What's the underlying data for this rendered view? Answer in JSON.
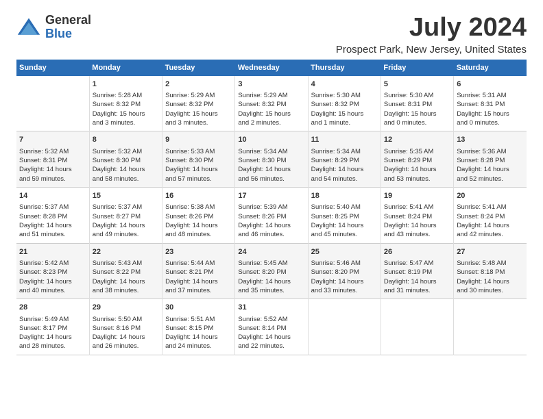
{
  "logo": {
    "general": "General",
    "blue": "Blue"
  },
  "title": "July 2024",
  "location": "Prospect Park, New Jersey, United States",
  "headers": [
    "Sunday",
    "Monday",
    "Tuesday",
    "Wednesday",
    "Thursday",
    "Friday",
    "Saturday"
  ],
  "weeks": [
    [
      {
        "day": "",
        "content": ""
      },
      {
        "day": "1",
        "content": "Sunrise: 5:28 AM\nSunset: 8:32 PM\nDaylight: 15 hours\nand 3 minutes."
      },
      {
        "day": "2",
        "content": "Sunrise: 5:29 AM\nSunset: 8:32 PM\nDaylight: 15 hours\nand 3 minutes."
      },
      {
        "day": "3",
        "content": "Sunrise: 5:29 AM\nSunset: 8:32 PM\nDaylight: 15 hours\nand 2 minutes."
      },
      {
        "day": "4",
        "content": "Sunrise: 5:30 AM\nSunset: 8:32 PM\nDaylight: 15 hours\nand 1 minute."
      },
      {
        "day": "5",
        "content": "Sunrise: 5:30 AM\nSunset: 8:31 PM\nDaylight: 15 hours\nand 0 minutes."
      },
      {
        "day": "6",
        "content": "Sunrise: 5:31 AM\nSunset: 8:31 PM\nDaylight: 15 hours\nand 0 minutes."
      }
    ],
    [
      {
        "day": "7",
        "content": "Sunrise: 5:32 AM\nSunset: 8:31 PM\nDaylight: 14 hours\nand 59 minutes."
      },
      {
        "day": "8",
        "content": "Sunrise: 5:32 AM\nSunset: 8:30 PM\nDaylight: 14 hours\nand 58 minutes."
      },
      {
        "day": "9",
        "content": "Sunrise: 5:33 AM\nSunset: 8:30 PM\nDaylight: 14 hours\nand 57 minutes."
      },
      {
        "day": "10",
        "content": "Sunrise: 5:34 AM\nSunset: 8:30 PM\nDaylight: 14 hours\nand 56 minutes."
      },
      {
        "day": "11",
        "content": "Sunrise: 5:34 AM\nSunset: 8:29 PM\nDaylight: 14 hours\nand 54 minutes."
      },
      {
        "day": "12",
        "content": "Sunrise: 5:35 AM\nSunset: 8:29 PM\nDaylight: 14 hours\nand 53 minutes."
      },
      {
        "day": "13",
        "content": "Sunrise: 5:36 AM\nSunset: 8:28 PM\nDaylight: 14 hours\nand 52 minutes."
      }
    ],
    [
      {
        "day": "14",
        "content": "Sunrise: 5:37 AM\nSunset: 8:28 PM\nDaylight: 14 hours\nand 51 minutes."
      },
      {
        "day": "15",
        "content": "Sunrise: 5:37 AM\nSunset: 8:27 PM\nDaylight: 14 hours\nand 49 minutes."
      },
      {
        "day": "16",
        "content": "Sunrise: 5:38 AM\nSunset: 8:26 PM\nDaylight: 14 hours\nand 48 minutes."
      },
      {
        "day": "17",
        "content": "Sunrise: 5:39 AM\nSunset: 8:26 PM\nDaylight: 14 hours\nand 46 minutes."
      },
      {
        "day": "18",
        "content": "Sunrise: 5:40 AM\nSunset: 8:25 PM\nDaylight: 14 hours\nand 45 minutes."
      },
      {
        "day": "19",
        "content": "Sunrise: 5:41 AM\nSunset: 8:24 PM\nDaylight: 14 hours\nand 43 minutes."
      },
      {
        "day": "20",
        "content": "Sunrise: 5:41 AM\nSunset: 8:24 PM\nDaylight: 14 hours\nand 42 minutes."
      }
    ],
    [
      {
        "day": "21",
        "content": "Sunrise: 5:42 AM\nSunset: 8:23 PM\nDaylight: 14 hours\nand 40 minutes."
      },
      {
        "day": "22",
        "content": "Sunrise: 5:43 AM\nSunset: 8:22 PM\nDaylight: 14 hours\nand 38 minutes."
      },
      {
        "day": "23",
        "content": "Sunrise: 5:44 AM\nSunset: 8:21 PM\nDaylight: 14 hours\nand 37 minutes."
      },
      {
        "day": "24",
        "content": "Sunrise: 5:45 AM\nSunset: 8:20 PM\nDaylight: 14 hours\nand 35 minutes."
      },
      {
        "day": "25",
        "content": "Sunrise: 5:46 AM\nSunset: 8:20 PM\nDaylight: 14 hours\nand 33 minutes."
      },
      {
        "day": "26",
        "content": "Sunrise: 5:47 AM\nSunset: 8:19 PM\nDaylight: 14 hours\nand 31 minutes."
      },
      {
        "day": "27",
        "content": "Sunrise: 5:48 AM\nSunset: 8:18 PM\nDaylight: 14 hours\nand 30 minutes."
      }
    ],
    [
      {
        "day": "28",
        "content": "Sunrise: 5:49 AM\nSunset: 8:17 PM\nDaylight: 14 hours\nand 28 minutes."
      },
      {
        "day": "29",
        "content": "Sunrise: 5:50 AM\nSunset: 8:16 PM\nDaylight: 14 hours\nand 26 minutes."
      },
      {
        "day": "30",
        "content": "Sunrise: 5:51 AM\nSunset: 8:15 PM\nDaylight: 14 hours\nand 24 minutes."
      },
      {
        "day": "31",
        "content": "Sunrise: 5:52 AM\nSunset: 8:14 PM\nDaylight: 14 hours\nand 22 minutes."
      },
      {
        "day": "",
        "content": ""
      },
      {
        "day": "",
        "content": ""
      },
      {
        "day": "",
        "content": ""
      }
    ]
  ]
}
